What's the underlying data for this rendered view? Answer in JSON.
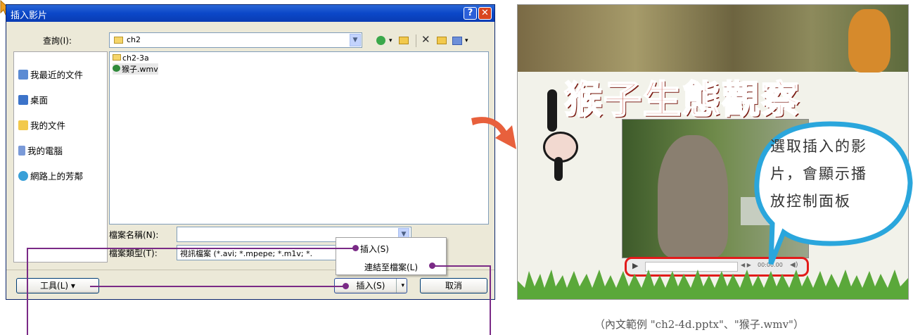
{
  "dialog": {
    "title": "插入影片",
    "help_btn": "?",
    "close_btn": "✕",
    "lookin_label": "查詢(I):",
    "lookin_value": "ch2",
    "places": [
      "我最近的文件",
      "桌面",
      "我的文件",
      "我的電腦",
      "網路上的芳鄰"
    ],
    "files": [
      "ch2-3a",
      "猴子.wmv"
    ],
    "filename_label": "檔案名稱(N):",
    "filename_value": "",
    "filetype_label": "檔案類型(T):",
    "filetype_value": "視訊檔案 (*.avi; *.mpepe; *.m1v; *.",
    "tools_btn": "工具(L)",
    "insert_btn": "插入(S)",
    "cancel_btn": "取消",
    "menu_items": [
      "插入(S)",
      "連結至檔案(L)"
    ]
  },
  "slide": {
    "title": "猴子生態觀察",
    "player_time": "00:00.00",
    "bubble_lines": [
      "選取插入的影",
      "片，會顯示播",
      "放控制面板"
    ]
  },
  "caption": "（內文範例 \"ch2-4d.pptx\"、\"猴子.wmv\"）",
  "colors": {
    "title_blue": "#0b47c8",
    "callout_line": "#7a2a86",
    "arrow_orange": "#e8603c",
    "bubble_border": "#2aa6dc",
    "highlight_red": "#e21b1b"
  }
}
